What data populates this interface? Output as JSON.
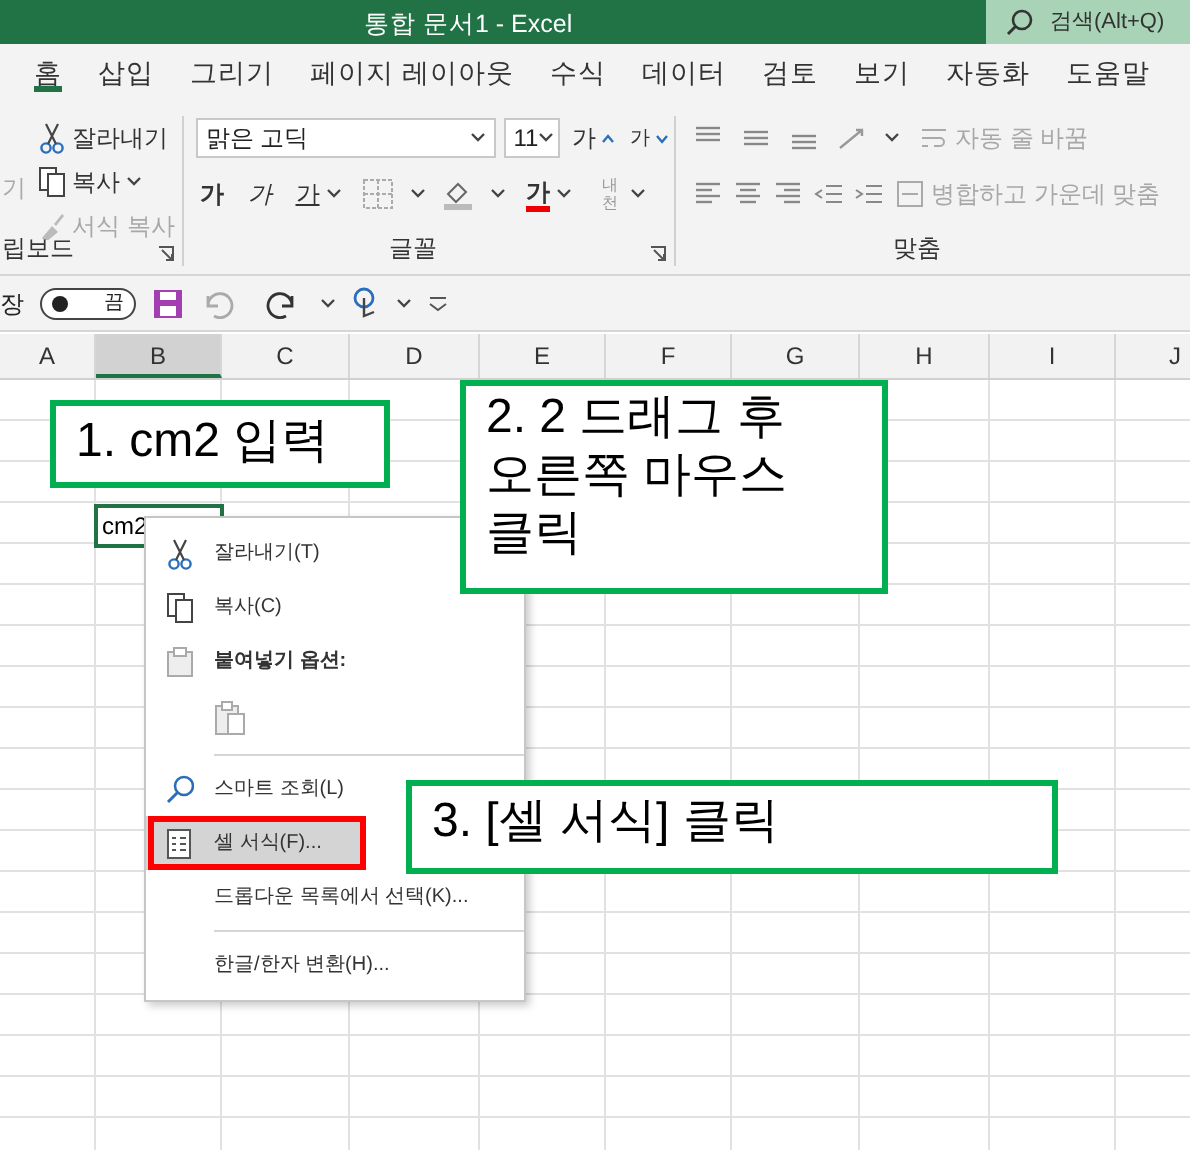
{
  "window": {
    "title": "통합 문서1  -  Excel",
    "search": {
      "placeholder": "검색(Alt+Q)"
    }
  },
  "tabs": [
    {
      "label": "홈",
      "selected": true
    },
    {
      "label": "삽입",
      "selected": false
    },
    {
      "label": "그리기",
      "selected": false
    },
    {
      "label": "페이지 레이아웃",
      "selected": false
    },
    {
      "label": "수식",
      "selected": false
    },
    {
      "label": "데이터",
      "selected": false
    },
    {
      "label": "검토",
      "selected": false
    },
    {
      "label": "보기",
      "selected": false
    },
    {
      "label": "자동화",
      "selected": false
    },
    {
      "label": "도움말",
      "selected": false
    }
  ],
  "ribbon": {
    "clipboard": {
      "paste_label": "기",
      "cut": {
        "label": "잘라내기",
        "disabled": false
      },
      "copy": {
        "label": "복사",
        "disabled": false
      },
      "format_painter": {
        "label": "서식 복사",
        "disabled": true
      },
      "group_label": "립보드"
    },
    "font": {
      "font_name": "맑은 고딕",
      "font_size": "11",
      "grow": "가",
      "shrink": "가",
      "bold": "가",
      "italic": "가",
      "underline": "가",
      "font_color": "가",
      "phonetic": "내천",
      "group_label": "글꼴"
    },
    "alignment": {
      "wrap_text": {
        "label": "자동 줄 바꿈",
        "disabled": true
      },
      "merge_center": {
        "label": "병합하고 가운데 맞춤",
        "disabled": true
      },
      "group_label": "맞춤"
    }
  },
  "quick_access": {
    "autosave_label": "장",
    "autosave": {
      "label": "끔",
      "on": false
    }
  },
  "columns": [
    {
      "label": "A",
      "selected": false
    },
    {
      "label": "B",
      "selected": true
    },
    {
      "label": "C",
      "selected": false
    },
    {
      "label": "D",
      "selected": false
    },
    {
      "label": "E",
      "selected": false
    },
    {
      "label": "F",
      "selected": false
    },
    {
      "label": "G",
      "selected": false
    },
    {
      "label": "H",
      "selected": false
    },
    {
      "label": "I",
      "selected": false
    },
    {
      "label": "J",
      "selected": false
    }
  ],
  "active_cell": {
    "text": "cm2"
  },
  "context_menu": [
    {
      "kind": "command",
      "label": "잘라내기(T)",
      "selected": false,
      "outlined": false
    },
    {
      "kind": "command",
      "label": "복사(C)",
      "selected": false,
      "outlined": false
    },
    {
      "kind": "heading",
      "label": "붙여넣기 옵션:"
    },
    {
      "kind": "paste-option"
    },
    {
      "kind": "separator"
    },
    {
      "kind": "command",
      "label": "스마트 조회(L)",
      "selected": false,
      "outlined": false
    },
    {
      "kind": "command",
      "label": "셀 서식(F)...",
      "selected": true,
      "outlined": true
    },
    {
      "kind": "command",
      "label": "드롭다운 목록에서 선택(K)...",
      "selected": false,
      "outlined": false
    },
    {
      "kind": "separator"
    },
    {
      "kind": "command",
      "label": "한글/한자 변환(H)...",
      "selected": false,
      "outlined": false
    }
  ],
  "callouts": [
    {
      "text": "1. cm2 입력"
    },
    {
      "text": "2. 2 드래그 후\n오른쪽 마우스\n클릭"
    },
    {
      "text": "3. [셀 서식] 클릭"
    }
  ]
}
